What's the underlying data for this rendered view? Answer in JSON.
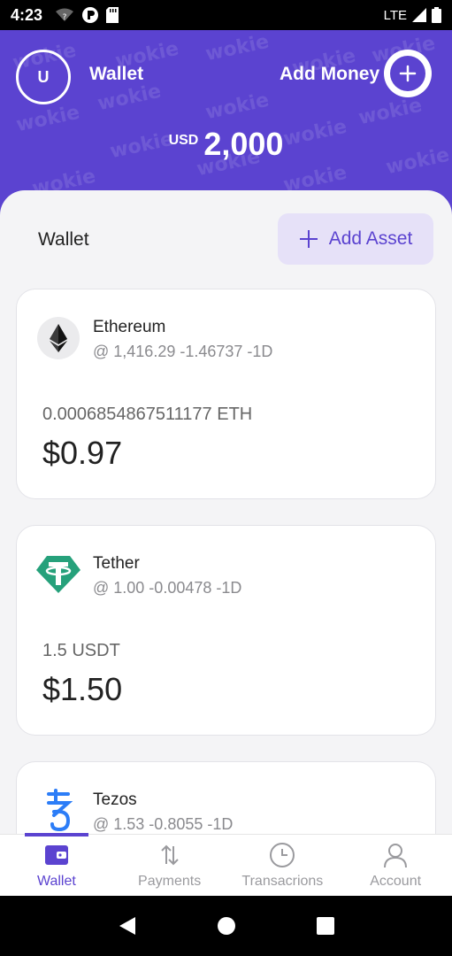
{
  "status_bar": {
    "time": "4:23",
    "network": "LTE"
  },
  "header": {
    "avatar_initial": "U",
    "title": "Wallet",
    "add_money_label": "Add Money",
    "balance_currency": "USD",
    "balance_amount": "2,000",
    "watermark_text": "wokie"
  },
  "wallet": {
    "title": "Wallet",
    "add_asset_label": "Add Asset",
    "assets": [
      {
        "name": "Ethereum",
        "rate": "@ 1,416.29  -1.46737 -1D",
        "quantity": "0.0006854867511177 ETH",
        "value": "$0.97",
        "icon": "ethereum-icon"
      },
      {
        "name": "Tether",
        "rate": "@ 1.00  -0.00478 -1D",
        "quantity": "1.5 USDT",
        "value": "$1.50",
        "icon": "tether-icon",
        "color": "#26a17b"
      },
      {
        "name": "Tezos",
        "rate": "@ 1.53  -0.8055 -1D",
        "quantity": "",
        "value": "",
        "icon": "tezos-icon",
        "color": "#2c7df7"
      }
    ]
  },
  "nav": {
    "items": [
      {
        "label": "Wallet",
        "icon": "wallet-icon",
        "active": true
      },
      {
        "label": "Payments",
        "icon": "payments-icon"
      },
      {
        "label": "Transacrions",
        "icon": "clock-icon"
      },
      {
        "label": "Account",
        "icon": "account-icon"
      }
    ]
  },
  "colors": {
    "brand": "#5b43d0",
    "sheet_bg": "#f4f4f6"
  }
}
